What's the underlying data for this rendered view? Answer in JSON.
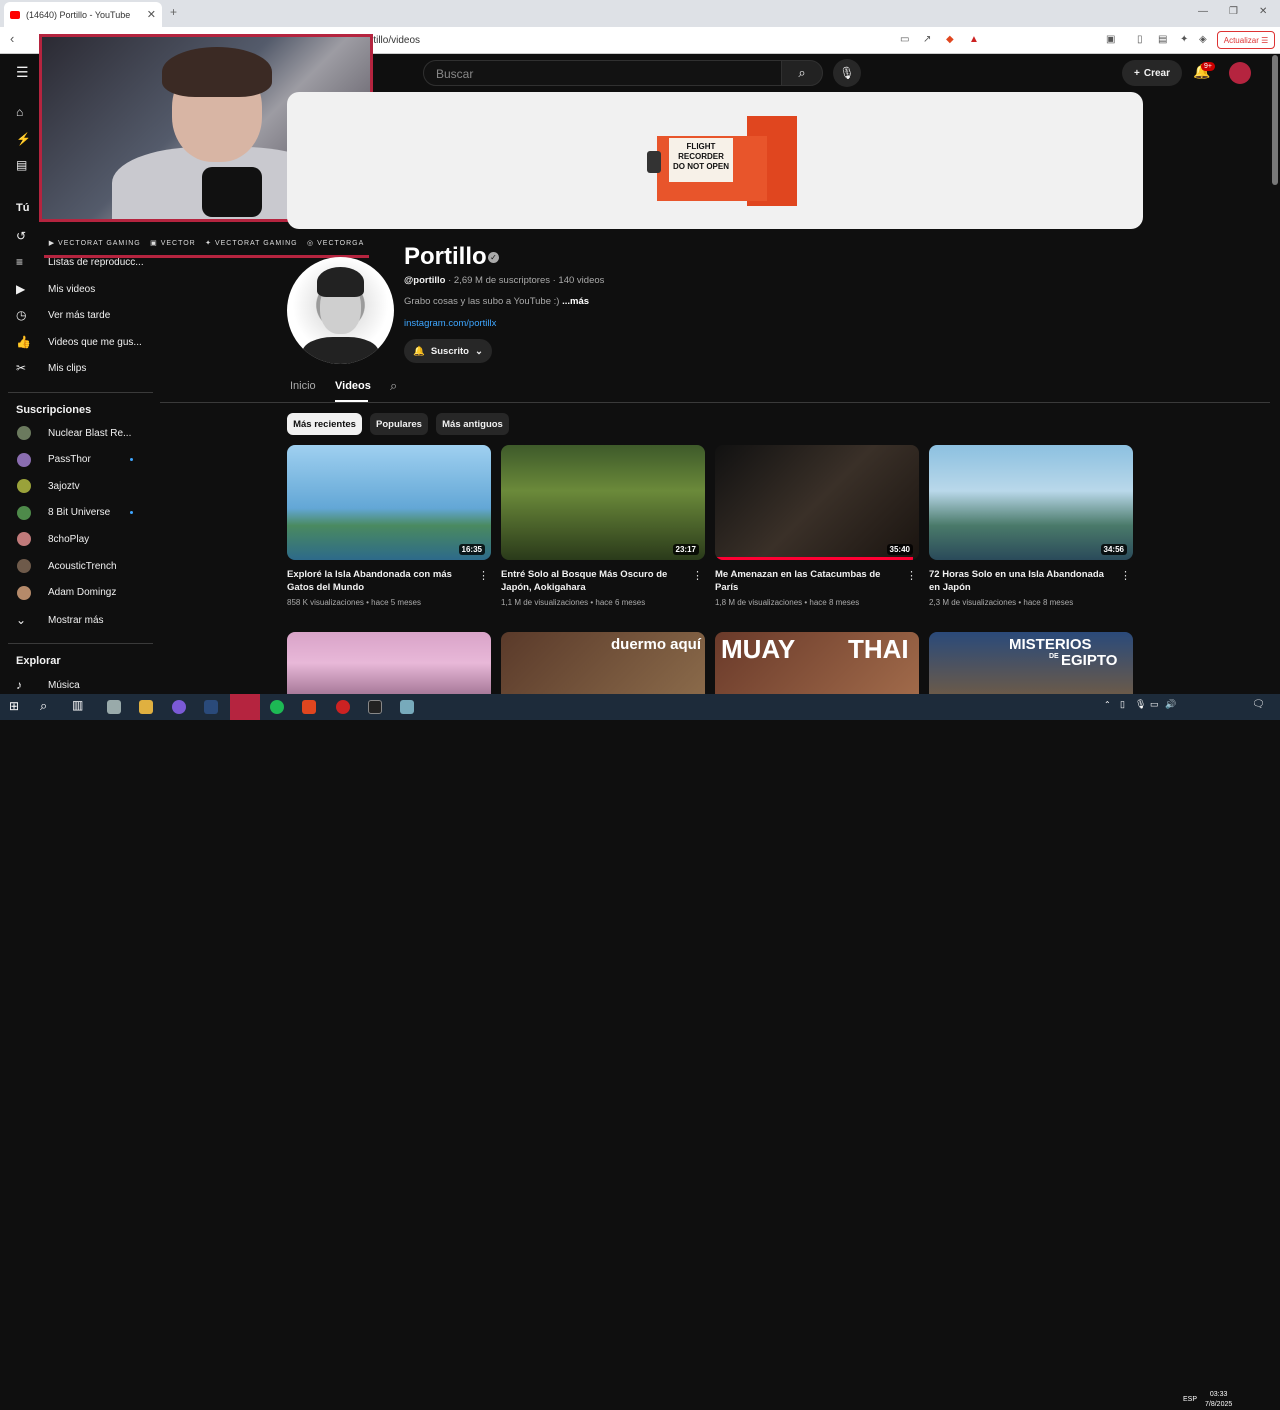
{
  "browser": {
    "tab_title": "(14640) Portillo - YouTube",
    "url": "rtillo/videos",
    "update_label": "Actualizar"
  },
  "header": {
    "search_placeholder": "Buscar",
    "create_label": "Crear",
    "notifications_badge": "9+"
  },
  "overlay": {
    "social_1": "VECTORAT GAMING",
    "social_2": "VECTOR",
    "social_3": "VECTORAT GAMING",
    "social_4": "VECTORGA"
  },
  "sidebar": {
    "you_heading": "Tú",
    "playlists": "Listas de reproducc...",
    "items": [
      "Mis videos",
      "Ver más tarde",
      "Videos que me gus...",
      "Mis clips"
    ],
    "subs_heading": "Suscripciones",
    "subs": [
      {
        "name": "Nuclear Blast Re...",
        "color": "#6b7a5e"
      },
      {
        "name": "PassThor",
        "color": "#8a6db0"
      },
      {
        "name": "3ajoztv",
        "color": "#9aa23a"
      },
      {
        "name": "8 Bit Universe",
        "color": "#4e8a4a"
      },
      {
        "name": "8choPlay",
        "color": "#c07a7a"
      },
      {
        "name": "AcousticTrench",
        "color": "#6e5a4a"
      },
      {
        "name": "Adam Domingz",
        "color": "#b58a6a"
      }
    ],
    "show_more": "Mostrar más",
    "explore_heading": "Explorar",
    "music": "Música"
  },
  "banner": {
    "label_line1": "FLIGHT",
    "label_line2": "RECORDER",
    "label_line3": "DO NOT OPEN"
  },
  "channel": {
    "name": "Portillo",
    "handle": "@portillo",
    "stats": " · 2,69 M de suscriptores · 140 videos",
    "description": "Grabo cosas y las subo a YouTube :) ",
    "more": "...más",
    "link": "instagram.com/portillx",
    "subscribed_label": "Suscrito"
  },
  "tabs": {
    "home": "Inicio",
    "videos": "Videos"
  },
  "chips": [
    "Más recientes",
    "Populares",
    "Más antiguos"
  ],
  "videos": [
    {
      "title": "Exploré la Isla Abandonada con más Gatos del Mundo",
      "meta": "858 K visualizaciones • hace 5 meses",
      "duration": "16:35",
      "progress": 0
    },
    {
      "title": "Entré Solo al Bosque Más Oscuro de Japón, Aokigahara",
      "meta": "1,1 M de visualizaciones • hace 6 meses",
      "duration": "23:17",
      "progress": 0
    },
    {
      "title": "Me Amenazan en las Catacumbas de París",
      "meta": "1,8 M de visualizaciones • hace 8 meses",
      "duration": "35:40",
      "progress": 0.97
    },
    {
      "title": "72 Horas Solo en una Isla Abandonada en Japón",
      "meta": "2,3 M de visualizaciones • hace 8 meses",
      "duration": "34:56",
      "progress": 0
    }
  ],
  "row2": {
    "t2_text": "duermo aquí",
    "t3_left": "MUAY",
    "t3_right": "THAI",
    "t4_line1": "MISTERIOS",
    "t4_line2": "DE",
    "t4_line3": "EGIPTO"
  },
  "taskbar": {
    "lang": "ESP",
    "time": "03:33",
    "date": "7/8/2025"
  }
}
